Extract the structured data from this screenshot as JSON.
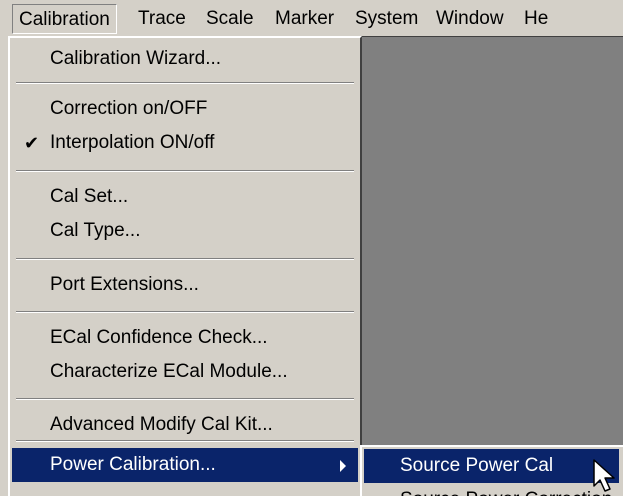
{
  "menubar": {
    "items": [
      {
        "label": "Calibration"
      },
      {
        "label": "Trace"
      },
      {
        "label": "Scale"
      },
      {
        "label": "Marker"
      },
      {
        "label": "System"
      },
      {
        "label": "Window"
      },
      {
        "label": "He"
      }
    ]
  },
  "calibration_menu": {
    "items": [
      {
        "label": "Calibration Wizard..."
      },
      {
        "label": "Correction on/OFF"
      },
      {
        "label": "Interpolation ON/off",
        "checked": true,
        "check_glyph": "✔"
      },
      {
        "label": "Cal Set..."
      },
      {
        "label": "Cal Type..."
      },
      {
        "label": "Port Extensions..."
      },
      {
        "label": "ECal Confidence Check..."
      },
      {
        "label": "Characterize ECal Module..."
      },
      {
        "label": "Advanced Modify Cal Kit..."
      },
      {
        "label": "Power Calibration...",
        "has_submenu": true
      }
    ]
  },
  "power_calibration_submenu": {
    "items": [
      {
        "label": "Source Power Cal"
      },
      {
        "label": "Source Power Correction"
      }
    ]
  },
  "colors": {
    "menu_bg": "#d4d0c8",
    "highlight": "#0a246a",
    "workspace": "#808080"
  },
  "icons": {
    "check": "check-icon",
    "submenu_arrow": "submenu-arrow-icon",
    "cursor": "mouse-cursor-icon"
  }
}
